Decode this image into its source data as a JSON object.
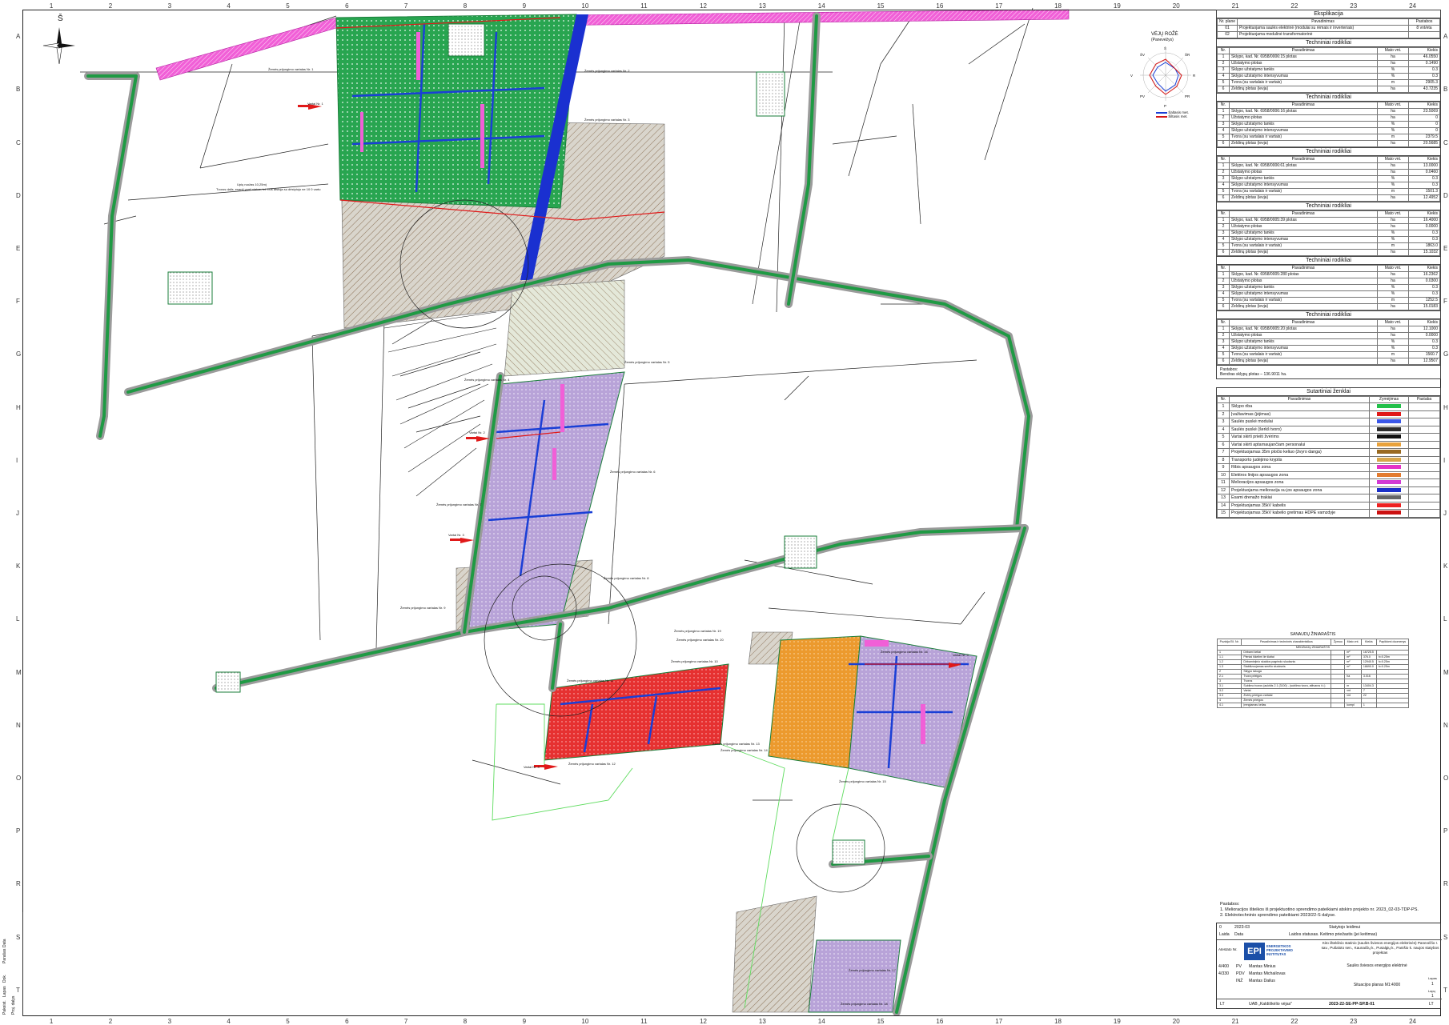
{
  "sheet": {
    "north_label": "Š",
    "columns": [
      "1",
      "2",
      "3",
      "4",
      "5",
      "6",
      "7",
      "8",
      "9",
      "10",
      "11",
      "12",
      "13",
      "14",
      "15",
      "16",
      "17",
      "18",
      "19",
      "20",
      "21",
      "22",
      "23",
      "24"
    ],
    "rows": [
      "A",
      "B",
      "C",
      "D",
      "E",
      "F",
      "G",
      "H",
      "I",
      "J",
      "K",
      "L",
      "M",
      "N",
      "O",
      "P",
      "R",
      "S",
      "T"
    ]
  },
  "map_labels": {
    "transect_1": "Žemės prijungimo vartalas Nr. 1",
    "transect_2": "Žemės prijungimo vartalas Nr. 2",
    "transect_3": "Žemės prijungimo vartalas Nr. 3",
    "transect_4": "Žemės prijungimo vartalas Nr. 4",
    "transect_5": "Žemės prijungimo vartalas Nr. 5",
    "transect_6": "Žemės prijungimo vartalas Nr. 6",
    "transect_7": "Žemės prijungimo vartalas Nr. 7",
    "transect_8": "Žemės prijungimo vartalas Nr. 8",
    "transect_9": "Žemės prijungimo vartalas Nr. 9",
    "transect_10": "Žemės prijungimo vartalas Nr. 10",
    "transect_11": "Žemės prijungimo vartalas Nr. 11",
    "transect_12": "Žemės prijungimo vartalas Nr. 12",
    "transect_13": "Žemės prijungimo vartalas Nr. 13",
    "transect_14": "Žemės prijungimo vartalas Nr. 14",
    "transect_15": "Žemės prijungimo vartalas Nr. 15",
    "transect_16": "Žemės prijungimo vartalas Nr. 16",
    "transect_17": "Žemės prijungimo vartalas Nr. 17",
    "transect_18": "Žemės prijungimo vartalas Nr. 18",
    "transect_19": "Žemės prijungimo vartalas Nr. 19",
    "transect_20": "Žemės prijungimo vartalas Nr. 20",
    "gate_1": "Vartai Nr. 1",
    "gate_2": "Vartai Nr. 2",
    "gate_3": "Vartai Nr. 3",
    "gate_4": "Vartai Nr. 4",
    "gate_5": "Vartai Nr. 5",
    "spring_note_1": "Upių ruožas 10,25m)",
    "spring_note_2": "Tvoros dalis, esanti ypač vietos, tvt. bus atstoja su dėstytojo ne 10 0 vartu"
  },
  "wind_rose": {
    "title": "VĖJŲ ROŽĖ",
    "subtitle": "(Panevėžys)",
    "dirs": [
      "Š",
      "ŠR",
      "R",
      "PR",
      "P",
      "PV",
      "V",
      "ŠV"
    ],
    "legend": [
      {
        "label": "Šaltasis met.",
        "color": "#1a3fd6"
      },
      {
        "label": "Šiltasis met.",
        "color": "#d41515"
      }
    ]
  },
  "explication": {
    "title": "Eksplikacija",
    "headers": [
      "Nr. plane",
      "Pavadinimas",
      "Pastabos"
    ],
    "rows": [
      [
        "01",
        "Projektuojama saulės elektrinė (modulai su rėmais ir inverteriais)",
        "8 vnt/eta"
      ],
      [
        "02",
        "Projektuojama modulinė transformatorinė",
        ""
      ]
    ]
  },
  "tech_tables": [
    {
      "title": "Techniniai rodikliai",
      "headers": [
        "Nr.",
        "Pavadinimas",
        "Mato vnt.",
        "Kiekis"
      ],
      "rows": [
        [
          "1",
          "Sklypo, kad. Nr. 6958/0006:15 plotas",
          "ha",
          "46.0550"
        ],
        [
          "2",
          "Užstatymo plotas",
          "ha",
          "0.1490"
        ],
        [
          "3",
          "Sklypo užstatymo tankis",
          "%",
          "0.3"
        ],
        [
          "4",
          "Sklypo užstatymo intensyvumas",
          "%",
          "0.3"
        ],
        [
          "5",
          "Tvora (su vartalais ir vartais)",
          "m",
          "2905.3"
        ],
        [
          "6",
          "Želdinų plotas (ievja)",
          "ha",
          "43.7235"
        ]
      ]
    },
    {
      "title": "Techniniai rodikliai",
      "headers": [
        "Nr.",
        "Pavadinimas",
        "Mato vnt.",
        "Kiekis"
      ],
      "rows": [
        [
          "1",
          "Sklypo, kad. Nr. 6958/0006:16 plotas",
          "ha",
          "23.5069"
        ],
        [
          "2",
          "Užstatymo plotas",
          "ha",
          "0"
        ],
        [
          "3",
          "Sklypo užstatymo tankis",
          "%",
          "0"
        ],
        [
          "4",
          "Sklypo užstatymo intensyvumas",
          "%",
          "0"
        ],
        [
          "5",
          "Tvora (su vartalais ir vartais)",
          "m",
          "2379.5"
        ],
        [
          "6",
          "Želdinų plotas (ievja)",
          "ha",
          "20.5685"
        ]
      ]
    },
    {
      "title": "Techniniai rodikliai",
      "headers": [
        "Nr.",
        "Pavadinimas",
        "Mato vnt.",
        "Kiekis"
      ],
      "rows": [
        [
          "1",
          "Sklypo, kad. Nr. 6958/0006:61 plotas",
          "ha",
          "13.0000"
        ],
        [
          "2",
          "Užstatymo plotas",
          "ha",
          "0.0460"
        ],
        [
          "3",
          "Sklypo užstatymo tankis",
          "%",
          "0.3"
        ],
        [
          "4",
          "Sklypo užstatymo intensyvumas",
          "%",
          "0.3"
        ],
        [
          "5",
          "Tvora (su vartalais ir vartais)",
          "m",
          "1501.3"
        ],
        [
          "6",
          "Želdinų plotas (ievja)",
          "ha",
          "12.4952"
        ]
      ]
    },
    {
      "title": "Techniniai rodikliai",
      "headers": [
        "Nr.",
        "Pavadinimas",
        "Mato vnt.",
        "Kiekis"
      ],
      "rows": [
        [
          "1",
          "Sklypo, kad. Nr. 6958/0005:39 plotas",
          "ha",
          "16.4000"
        ],
        [
          "2",
          "Užstatymo plotas",
          "ha",
          "0.0000"
        ],
        [
          "3",
          "Sklypo užstatymo tankis",
          "%",
          "0.3"
        ],
        [
          "4",
          "Sklypo užstatymo intensyvumas",
          "%",
          "0.3"
        ],
        [
          "5",
          "Tvora (su vartalais ir vartais)",
          "m",
          "1863.0"
        ],
        [
          "6",
          "Želdinų plotas (ievja)",
          "ha",
          "15.1032"
        ]
      ]
    },
    {
      "title": "Techniniai rodikliai",
      "headers": [
        "Nr.",
        "Pavadinimas",
        "Mato vnt.",
        "Kiekis"
      ],
      "rows": [
        [
          "1",
          "Sklypo, kad. Nr. 6958/0005:280 plotas",
          "ha",
          "16.2362"
        ],
        [
          "2",
          "Užstatymo plotas",
          "ha",
          "0.0300"
        ],
        [
          "3",
          "Sklypo užstatymo tankis",
          "%",
          "0.3"
        ],
        [
          "4",
          "Sklypo užstatymo intensyvumas",
          "%",
          "0.3"
        ],
        [
          "5",
          "Tvora (su vartalais ir vartais)",
          "m",
          "1252.5"
        ],
        [
          "6",
          "Želdinų plotas (ievja)",
          "ha",
          "15.0183"
        ]
      ]
    },
    {
      "title": "Techniniai rodikliai",
      "headers": [
        "Nr.",
        "Pavadinimas",
        "Mato vnt.",
        "Kiekis"
      ],
      "rows": [
        [
          "1",
          "Sklypo, kad. Nr. 6958/0005:20 plotas",
          "ha",
          "12.1000"
        ],
        [
          "2",
          "Užstatymo plotas",
          "ha",
          "0.0000"
        ],
        [
          "3",
          "Sklypo užstatymo tankis",
          "%",
          "0.3"
        ],
        [
          "4",
          "Sklypo užstatymo intensyvumas",
          "%",
          "0.3"
        ],
        [
          "5",
          "Tvora (su vartalais ir vartais)",
          "m",
          "1560.7"
        ],
        [
          "6",
          "Želdinų plotas (ievja)",
          "ha",
          "12.9507"
        ]
      ]
    }
  ],
  "tech_note": {
    "title": "Pastabos:",
    "text": "Bendras sklypų plotas – 136.9011 ha."
  },
  "legend": {
    "title": "Sutartiniai ženklai",
    "headers": [
      "Nr.",
      "Pavadinimas",
      "Žymėjimas",
      "Pastaba"
    ],
    "rows": [
      {
        "n": "1",
        "label": "Sklypo riba",
        "swatch": "#22c04a"
      },
      {
        "n": "2",
        "label": "Įvažiavimas (įėjimas)",
        "swatch": "#e01919"
      },
      {
        "n": "3",
        "label": "Saulės puskė modulai",
        "swatch": "#3a57e8"
      },
      {
        "n": "4",
        "label": "Saulės puskė (šerkš tvoro)",
        "swatch": "#2b2b2b"
      },
      {
        "n": "5",
        "label": "Vartai skirti prieiti žvėrims",
        "swatch": "#111111"
      },
      {
        "n": "6",
        "label": "Vartai skirti aptarnaujančiam personalui",
        "swatch": "#e9a23b"
      },
      {
        "n": "7",
        "label": "Projektuojamas 35m pločio keliuo (žvyro danga)",
        "swatch": "#9a6a21"
      },
      {
        "n": "8",
        "label": "Transporto judėjimo kryptis",
        "swatch": "#d8a64a"
      },
      {
        "n": "9",
        "label": "Ribis apsaugos zona",
        "swatch": "#e533c8"
      },
      {
        "n": "10",
        "label": "Elektros linijos apsaugos zona",
        "swatch": "#e37b2f"
      },
      {
        "n": "11",
        "label": "Melioracijos apsaugos zona",
        "swatch": "#d23bd4"
      },
      {
        "n": "12",
        "label": "Projektuojama melioracija su jos apsaugos zona",
        "swatch": "#1b30c8"
      },
      {
        "n": "13",
        "label": "Esami drenažo trakiai",
        "swatch": "#666666"
      },
      {
        "n": "14",
        "label": "Projektuojamas 35kV kabelis",
        "swatch": "#ee2222"
      },
      {
        "n": "15",
        "label": "Projektuojamas 35kV kabelio gretimas HDPE vamzdyje",
        "swatch": "#cc1111"
      }
    ]
  },
  "ledger": {
    "title": "SANAUDŲ ŽINIARAŠTIS",
    "headers": [
      "Pozicija Eil. Nr.",
      "Pavadinimas ir techninės charakteristikos",
      "Žymuo",
      "Mato vnt.",
      "Kiekis",
      "Papildomi duomenys"
    ],
    "subtitle": "MEDŽIAGŲ ŽINIARAŠTIS",
    "rows": [
      [
        "1",
        "Dirbami keliai",
        "",
        "m²",
        "16725.5",
        ""
      ],
      [
        "1.1",
        "Pieniai iškelimi lie šlaitai",
        "",
        "m²",
        "376.0",
        "h=0.25m"
      ],
      [
        "1.2",
        "Dirbamiejinio skaldos pagrindo sluoksnis",
        "",
        "m²",
        "12940.5",
        "h=0.25m"
      ],
      [
        "1.3",
        "Stabilizuojamas smėlio sluoksnis",
        "",
        "m²",
        "18690.0",
        "h=0.25m"
      ],
      [
        "2",
        "Sklypo takuga",
        "",
        "",
        "",
        ""
      ],
      [
        "2.1",
        "Tvora prieigos",
        "",
        "ha",
        "3.016",
        ""
      ],
      [
        "3",
        "Tvoros",
        "",
        "",
        "",
        ""
      ],
      [
        "3.1",
        "Sublimo tvoros (aukštis 2.1 (3100) - (sublimo tvora, atitvaros t.t.)",
        "",
        "m",
        "13404.3",
        ""
      ],
      [
        "3.2",
        "Vartai",
        "",
        "vnt",
        "7",
        ""
      ],
      [
        "3.3",
        "Žvėrių prieigos vartalai",
        "",
        "vnt",
        "22",
        ""
      ],
      [
        "4",
        "Žemės prieigos",
        "",
        "",
        "",
        ""
      ],
      [
        "4.1",
        "Įrengiamas kelias",
        "",
        "kompl",
        "1",
        ""
      ]
    ]
  },
  "notes": {
    "title": "Pastabos:",
    "lines": [
      "1. Melioracijos išteikos iš projektuotino sprendimo pateikiami atskiro projekto nr. 2023_02-03-TDP-PS.",
      "2. Elektrotechninio sprendimo pateikiami 2023/22-S dalyse."
    ]
  },
  "titleblock": {
    "rev_rows": [
      [
        "0",
        "2023-03",
        "",
        "Statytojo leidimui"
      ],
      [
        "Laida",
        "Data",
        "",
        "Laidos statusas. Keitimo priežastis (jei keitimas)"
      ]
    ],
    "company_logo": "EPI",
    "company_name": "ENERGETIKOS PROJEKTAVIMO INSTITUTAS",
    "object_text": "Kito išteklinio statinio (saulės šviesos energijos elektrinės) Panevėžio r. sav., Pušaloto sen., Kaunaičių k., Pusalgių k., Panišio k. naujos statybos projektas",
    "staff": [
      [
        "4/400",
        "PV",
        "Mantas Minius"
      ],
      [
        "4/330",
        "PDV",
        "Mantas Michailovas"
      ],
      [
        "",
        "INŽ",
        "Mantas Dailus"
      ]
    ],
    "staff_label": "Atestato Nr.",
    "design_part": "Saulės šviesos energijos elektrinė",
    "sheet_title": "Situacijos planas M1:4000",
    "sheet_label": "Lapas",
    "sheet_no": "1",
    "sheets_label": "Lapų",
    "sheets_total": "1",
    "stage": "LT",
    "client": "UAB „Kaldiškėlio vėjas\"",
    "doc_no": "2023-22-SE-PP-SP.B-01",
    "lang": "LT"
  },
  "side_stamp": [
    "Pakeist.",
    "Lapas",
    "Dok.",
    "Parašas",
    "Data",
    "Proj. dalys"
  ]
}
